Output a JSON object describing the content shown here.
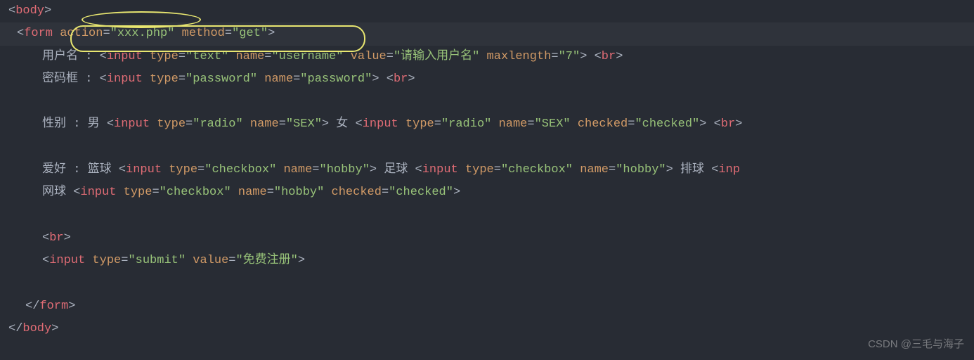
{
  "code": {
    "body_open": {
      "bracket_open": "<",
      "tag": "body",
      "bracket_close": ">"
    },
    "form_open": {
      "bracket_open": "<",
      "tag": "form",
      "space1": " ",
      "attr1": "action",
      "eq1": "=",
      "val1": "\"xxx.php\"",
      "space2": " ",
      "attr2": "method",
      "eq2": "=",
      "val2": "\"get\"",
      "bracket_close": ">"
    },
    "l3": {
      "label": "用户名 : ",
      "bo1": "<",
      "tag1": "input",
      "s1": " ",
      "a1": "type",
      "e1": "=",
      "v1": "\"text\"",
      "s2": " ",
      "a2": "name",
      "e2": "=",
      "v2": "\"username\"",
      "s3": " ",
      "a3": "value",
      "e3": "=",
      "v3": "\"请输入用户名\"",
      "s4": " ",
      "a4": "maxlength",
      "e4": "=",
      "v4": "\"7\"",
      "bc1": ">",
      "sp": " ",
      "bo2": "<",
      "tag2": "br",
      "bc2": ">"
    },
    "l4": {
      "label": "密码框 : ",
      "bo1": "<",
      "tag1": "input",
      "s1": " ",
      "a1": "type",
      "e1": "=",
      "v1": "\"password\"",
      "s2": " ",
      "a2": "name",
      "e2": "=",
      "v2": "\"password\"",
      "bc1": ">",
      "sp": " ",
      "bo2": "<",
      "tag2": "br",
      "bc2": ">"
    },
    "l6": {
      "label1": "性别 : 男 ",
      "bo1": "<",
      "tag1": "input",
      "s1": " ",
      "a1": "type",
      "e1": "=",
      "v1": "\"radio\"",
      "s2": " ",
      "a2": "name",
      "e2": "=",
      "v2": "\"SEX\"",
      "bc1": ">",
      "label2": " 女 ",
      "bo2": "<",
      "tag2": "input",
      "s3": " ",
      "a3": "type",
      "e3": "=",
      "v3": "\"radio\"",
      "s4": " ",
      "a4": "name",
      "e4": "=",
      "v4": "\"SEX\"",
      "s5": " ",
      "a5": "checked",
      "e5": "=",
      "v5": "\"checked\"",
      "bc2": ">",
      "sp": " ",
      "bo3": "<",
      "tag3": "br",
      "bc3": ">"
    },
    "l8": {
      "label1": "爱好 : 篮球 ",
      "bo1": "<",
      "tag1": "input",
      "s1": " ",
      "a1": "type",
      "e1": "=",
      "v1": "\"checkbox\"",
      "s2": " ",
      "a2": "name",
      "e2": "=",
      "v2": "\"hobby\"",
      "bc1": ">",
      "label2": " 足球 ",
      "bo2": "<",
      "tag2": "input",
      "s3": " ",
      "a3": "type",
      "e3": "=",
      "v3": "\"checkbox\"",
      "s4": " ",
      "a4": "name",
      "e4": "=",
      "v4": "\"hobby\"",
      "bc2": ">",
      "label3": " 排球 ",
      "bo3": "<",
      "tag3": "inp"
    },
    "l9": {
      "label": "网球 ",
      "bo1": "<",
      "tag1": "input",
      "s1": " ",
      "a1": "type",
      "e1": "=",
      "v1": "\"checkbox\"",
      "s2": " ",
      "a2": "name",
      "e2": "=",
      "v2": "\"hobby\"",
      "s3": " ",
      "a3": "checked",
      "e3": "=",
      "v3": "\"checked\"",
      "bc1": ">"
    },
    "l11": {
      "bo": "<",
      "tag": "br",
      "bc": ">"
    },
    "l12": {
      "bo1": "<",
      "tag1": "input",
      "s1": " ",
      "a1": "type",
      "e1": "=",
      "v1": "\"submit\"",
      "s2": " ",
      "a2": "value",
      "e2": "=",
      "v2": "\"免费注册\"",
      "bc1": ">"
    },
    "form_close": {
      "bo": "</",
      "tag": "form",
      "bc": ">"
    },
    "body_close": {
      "bo": "</",
      "tag": "body",
      "bc": ">"
    }
  },
  "watermark": "CSDN @三毛与海子"
}
